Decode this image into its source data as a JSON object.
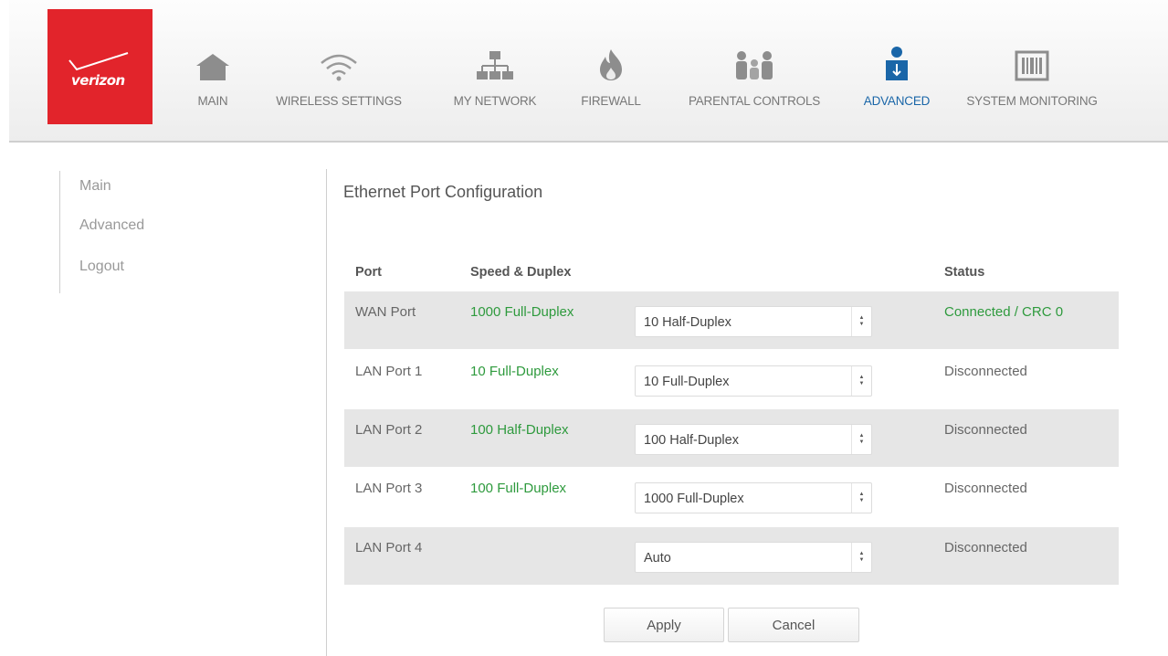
{
  "brand": {
    "logo_text": "verizon",
    "accent_color": "#e2242b",
    "logo_icon": "verizon-check-icon"
  },
  "nav": {
    "items": [
      {
        "label": "MAIN",
        "icon": "house-icon"
      },
      {
        "label": "WIRELESS SETTINGS",
        "icon": "wifi-icon"
      },
      {
        "label": "MY NETWORK",
        "icon": "network-icon"
      },
      {
        "label": "FIREWALL",
        "icon": "flame-icon"
      },
      {
        "label": "PARENTAL CONTROLS",
        "icon": "family-icon"
      },
      {
        "label": "ADVANCED",
        "icon": "advanced-user-icon",
        "active": true
      },
      {
        "label": "SYSTEM MONITORING",
        "icon": "monitor-icon"
      }
    ],
    "active_color": "#1a66a8"
  },
  "sidebar": {
    "items": [
      {
        "label": "Main"
      },
      {
        "label": "Advanced"
      },
      {
        "label": "Logout"
      }
    ]
  },
  "page": {
    "title": "Ethernet Port Configuration"
  },
  "table": {
    "headers": {
      "port": "Port",
      "speed": "Speed & Duplex",
      "status": "Status"
    },
    "rows": [
      {
        "port": "WAN Port",
        "speed": "1000 Full-Duplex",
        "setting": "10 Half-Duplex",
        "status": "Connected / CRC 0"
      },
      {
        "port": "LAN Port 1",
        "speed": "10 Full-Duplex",
        "setting": "10 Full-Duplex",
        "status": "Disconnected"
      },
      {
        "port": "LAN Port 2",
        "speed": "100 Half-Duplex",
        "setting": "100 Half-Duplex",
        "status": "Disconnected"
      },
      {
        "port": "LAN Port 3",
        "speed": "100 Full-Duplex",
        "setting": "1000 Full-Duplex",
        "status": "Disconnected"
      },
      {
        "port": "LAN Port 4",
        "speed": "",
        "setting": "Auto",
        "status": "Disconnected"
      }
    ],
    "speed_color": "#2e9a3d"
  },
  "actions": {
    "apply_label": "Apply",
    "cancel_label": "Cancel"
  }
}
